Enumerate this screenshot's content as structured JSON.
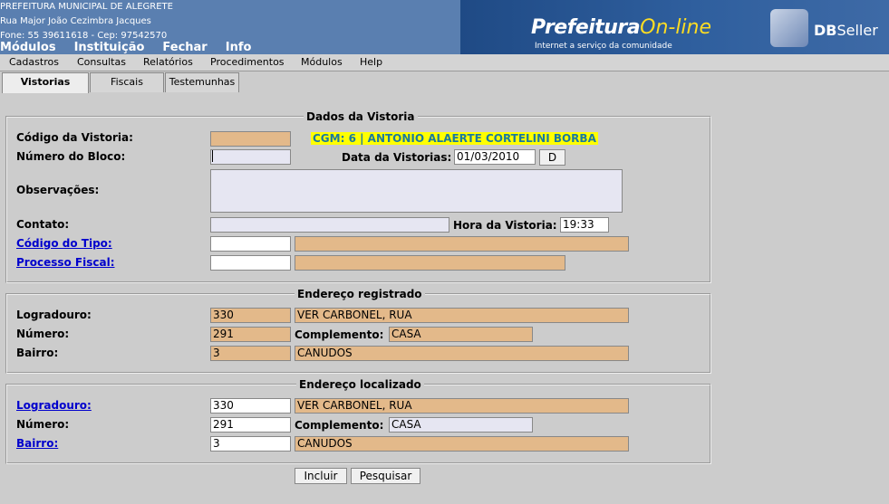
{
  "header": {
    "org_name": "PREFEITURA MUNICIPAL DE ALEGRETE",
    "address": "Rua Major João Cezimbra Jacques",
    "contact": "Fone: 55 39611618  -  Cep: 97542570",
    "main_menu": [
      "Módulos",
      "Instituição",
      "Fechar",
      "Info"
    ],
    "banner": {
      "brand_main": "Prefeitura",
      "brand_online": "On-line",
      "tagline": "Internet a serviço da comunidade",
      "vendor_bold": "DB",
      "vendor_rest": "Seller"
    }
  },
  "sub_menu": [
    "Cadastros",
    "Consultas",
    "Relatórios",
    "Procedimentos",
    "Módulos",
    "Help"
  ],
  "tabs": [
    {
      "label": "Vistorias",
      "active": true
    },
    {
      "label": "Fiscais",
      "active": false
    },
    {
      "label": "Testemunhas",
      "active": false
    }
  ],
  "dados_vistoria": {
    "legend": "Dados da Vistoria",
    "codigo_label": "Código da Vistoria:",
    "codigo_value": "",
    "cgm_text": "CGM: 6  | ANTONIO ALAERTE CORTELINI BORBA",
    "bloco_label": "Número do Bloco:",
    "bloco_value": "",
    "data_label": "Data da Vistorias:",
    "data_value": "01/03/2010",
    "data_button": "D",
    "obs_label": "Observações:",
    "obs_value": "",
    "contato_label": "Contato:",
    "contato_value": "",
    "hora_label": "Hora da Vistoria:",
    "hora_value": "19:33",
    "tipo_label": "Código do Tipo:",
    "tipo_code": "",
    "tipo_desc": "",
    "processo_label": "Processo Fiscal:",
    "processo_code": "",
    "processo_desc": ""
  },
  "endereco_registrado": {
    "legend": "Endereço registrado",
    "logradouro_label": "Logradouro:",
    "logradouro_code": "330",
    "logradouro_name": "VER CARBONEL, RUA",
    "numero_label": "Número:",
    "numero_value": "291",
    "complemento_label": "Complemento:",
    "complemento_value": "CASA",
    "bairro_label": "Bairro:",
    "bairro_code": "3",
    "bairro_name": "CANUDOS"
  },
  "endereco_localizado": {
    "legend": "Endereço localizado",
    "logradouro_label": "Logradouro:",
    "logradouro_code": "330",
    "logradouro_name": "VER CARBONEL, RUA",
    "numero_label": "Número:",
    "numero_value": "291",
    "complemento_label": "Complemento:",
    "complemento_value": "CASA",
    "bairro_label": "Bairro:",
    "bairro_code": "3",
    "bairro_name": "CANUDOS"
  },
  "buttons": {
    "incluir": "Incluir",
    "pesquisar": "Pesquisar"
  }
}
